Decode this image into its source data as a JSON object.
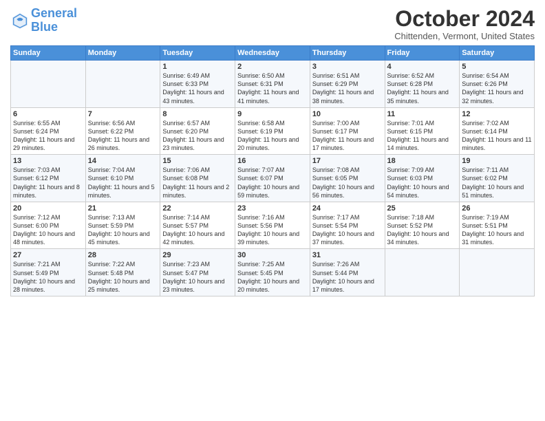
{
  "header": {
    "logo_line1": "General",
    "logo_line2": "Blue",
    "title": "October 2024",
    "subtitle": "Chittenden, Vermont, United States"
  },
  "days_of_week": [
    "Sunday",
    "Monday",
    "Tuesday",
    "Wednesday",
    "Thursday",
    "Friday",
    "Saturday"
  ],
  "weeks": [
    [
      {
        "day": "",
        "content": ""
      },
      {
        "day": "",
        "content": ""
      },
      {
        "day": "1",
        "content": "Sunrise: 6:49 AM\nSunset: 6:33 PM\nDaylight: 11 hours and 43 minutes."
      },
      {
        "day": "2",
        "content": "Sunrise: 6:50 AM\nSunset: 6:31 PM\nDaylight: 11 hours and 41 minutes."
      },
      {
        "day": "3",
        "content": "Sunrise: 6:51 AM\nSunset: 6:29 PM\nDaylight: 11 hours and 38 minutes."
      },
      {
        "day": "4",
        "content": "Sunrise: 6:52 AM\nSunset: 6:28 PM\nDaylight: 11 hours and 35 minutes."
      },
      {
        "day": "5",
        "content": "Sunrise: 6:54 AM\nSunset: 6:26 PM\nDaylight: 11 hours and 32 minutes."
      }
    ],
    [
      {
        "day": "6",
        "content": "Sunrise: 6:55 AM\nSunset: 6:24 PM\nDaylight: 11 hours and 29 minutes."
      },
      {
        "day": "7",
        "content": "Sunrise: 6:56 AM\nSunset: 6:22 PM\nDaylight: 11 hours and 26 minutes."
      },
      {
        "day": "8",
        "content": "Sunrise: 6:57 AM\nSunset: 6:20 PM\nDaylight: 11 hours and 23 minutes."
      },
      {
        "day": "9",
        "content": "Sunrise: 6:58 AM\nSunset: 6:19 PM\nDaylight: 11 hours and 20 minutes."
      },
      {
        "day": "10",
        "content": "Sunrise: 7:00 AM\nSunset: 6:17 PM\nDaylight: 11 hours and 17 minutes."
      },
      {
        "day": "11",
        "content": "Sunrise: 7:01 AM\nSunset: 6:15 PM\nDaylight: 11 hours and 14 minutes."
      },
      {
        "day": "12",
        "content": "Sunrise: 7:02 AM\nSunset: 6:14 PM\nDaylight: 11 hours and 11 minutes."
      }
    ],
    [
      {
        "day": "13",
        "content": "Sunrise: 7:03 AM\nSunset: 6:12 PM\nDaylight: 11 hours and 8 minutes."
      },
      {
        "day": "14",
        "content": "Sunrise: 7:04 AM\nSunset: 6:10 PM\nDaylight: 11 hours and 5 minutes."
      },
      {
        "day": "15",
        "content": "Sunrise: 7:06 AM\nSunset: 6:08 PM\nDaylight: 11 hours and 2 minutes."
      },
      {
        "day": "16",
        "content": "Sunrise: 7:07 AM\nSunset: 6:07 PM\nDaylight: 10 hours and 59 minutes."
      },
      {
        "day": "17",
        "content": "Sunrise: 7:08 AM\nSunset: 6:05 PM\nDaylight: 10 hours and 56 minutes."
      },
      {
        "day": "18",
        "content": "Sunrise: 7:09 AM\nSunset: 6:03 PM\nDaylight: 10 hours and 54 minutes."
      },
      {
        "day": "19",
        "content": "Sunrise: 7:11 AM\nSunset: 6:02 PM\nDaylight: 10 hours and 51 minutes."
      }
    ],
    [
      {
        "day": "20",
        "content": "Sunrise: 7:12 AM\nSunset: 6:00 PM\nDaylight: 10 hours and 48 minutes."
      },
      {
        "day": "21",
        "content": "Sunrise: 7:13 AM\nSunset: 5:59 PM\nDaylight: 10 hours and 45 minutes."
      },
      {
        "day": "22",
        "content": "Sunrise: 7:14 AM\nSunset: 5:57 PM\nDaylight: 10 hours and 42 minutes."
      },
      {
        "day": "23",
        "content": "Sunrise: 7:16 AM\nSunset: 5:56 PM\nDaylight: 10 hours and 39 minutes."
      },
      {
        "day": "24",
        "content": "Sunrise: 7:17 AM\nSunset: 5:54 PM\nDaylight: 10 hours and 37 minutes."
      },
      {
        "day": "25",
        "content": "Sunrise: 7:18 AM\nSunset: 5:52 PM\nDaylight: 10 hours and 34 minutes."
      },
      {
        "day": "26",
        "content": "Sunrise: 7:19 AM\nSunset: 5:51 PM\nDaylight: 10 hours and 31 minutes."
      }
    ],
    [
      {
        "day": "27",
        "content": "Sunrise: 7:21 AM\nSunset: 5:49 PM\nDaylight: 10 hours and 28 minutes."
      },
      {
        "day": "28",
        "content": "Sunrise: 7:22 AM\nSunset: 5:48 PM\nDaylight: 10 hours and 25 minutes."
      },
      {
        "day": "29",
        "content": "Sunrise: 7:23 AM\nSunset: 5:47 PM\nDaylight: 10 hours and 23 minutes."
      },
      {
        "day": "30",
        "content": "Sunrise: 7:25 AM\nSunset: 5:45 PM\nDaylight: 10 hours and 20 minutes."
      },
      {
        "day": "31",
        "content": "Sunrise: 7:26 AM\nSunset: 5:44 PM\nDaylight: 10 hours and 17 minutes."
      },
      {
        "day": "",
        "content": ""
      },
      {
        "day": "",
        "content": ""
      }
    ]
  ]
}
